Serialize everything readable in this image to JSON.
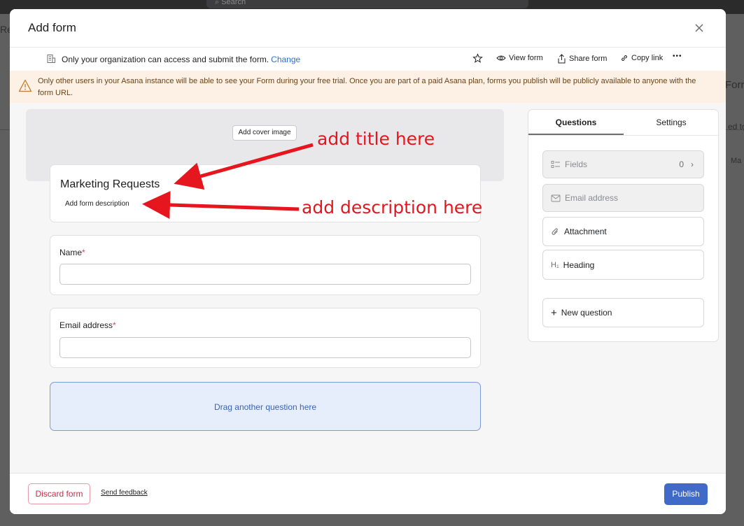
{
  "background": {
    "search_placeholder": "Search",
    "left_fragment": "Re",
    "right_fragments": [
      "Forr",
      "ed to",
      "Ma"
    ]
  },
  "modal": {
    "title": "Add form",
    "close_icon": "close-icon"
  },
  "access_bar": {
    "text": "Only your organization can access and submit the form.",
    "change_link": "Change",
    "actions": {
      "favorite_icon": "star-icon",
      "view_form": "View form",
      "share_form": "Share form",
      "copy_link": "Copy link",
      "more": "•••"
    }
  },
  "warning": {
    "icon": "warning-icon",
    "text": "Only other users in your Asana instance will be able to see your Form during your free trial. Once you are part of a paid Asana plan, forms you publish will be publicly available to anyone with the form URL."
  },
  "form": {
    "cover_button": "Add cover image",
    "title": "Marketing Requests",
    "description_placeholder": "Add form description",
    "questions": [
      {
        "label": "Name",
        "required_mark": "*"
      },
      {
        "label": "Email address",
        "required_mark": "*"
      }
    ],
    "dropzone_text": "Drag another question here"
  },
  "panel": {
    "tabs": {
      "questions": "Questions",
      "settings": "Settings"
    },
    "items": {
      "fields": {
        "label": "Fields",
        "count": "0",
        "chevron": "›"
      },
      "email": {
        "label": "Email address"
      },
      "attachment": {
        "label": "Attachment"
      },
      "heading": {
        "label": "Heading",
        "prefix": "H₁"
      },
      "new_question": {
        "label": "New question",
        "prefix": "+"
      }
    }
  },
  "footer": {
    "discard": "Discard form",
    "feedback": "Send feedback",
    "publish": "Publish"
  },
  "annotations": {
    "title_note": "add title here",
    "description_note": "add description here",
    "color": "#e5161d"
  },
  "colors": {
    "accent": "#3f6ac8",
    "link": "#2d6fd6",
    "warning_bg": "#fdf1e5",
    "danger": "#c92f45"
  }
}
